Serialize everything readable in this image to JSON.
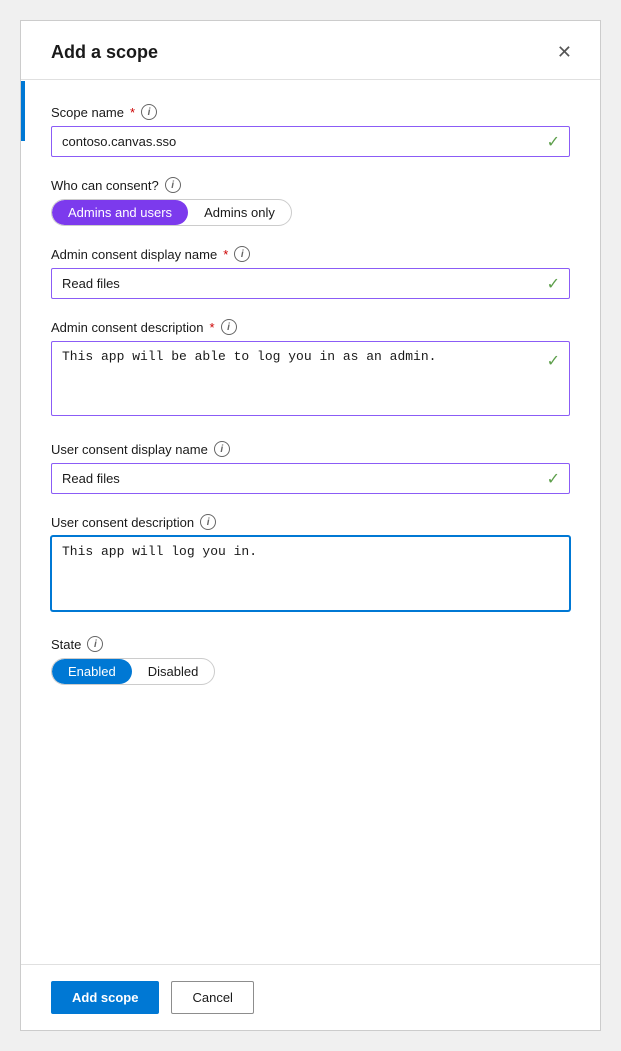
{
  "dialog": {
    "title": "Add a scope",
    "close_label": "✕"
  },
  "form": {
    "scope_name_label": "Scope name",
    "scope_name_value": "contoso.canvas.sso",
    "who_can_consent_label": "Who can consent?",
    "consent_option_admins_users": "Admins and users",
    "consent_option_admins_only": "Admins only",
    "admin_consent_display_name_label": "Admin consent display name",
    "admin_consent_display_name_value": "Read files",
    "admin_consent_description_label": "Admin consent description",
    "admin_consent_description_value": "This app will be able to log you in as an admin.",
    "user_consent_display_name_label": "User consent display name",
    "user_consent_display_name_value": "Read files",
    "user_consent_description_label": "User consent description",
    "user_consent_description_value": "This app will log you in.",
    "state_label": "State",
    "state_option_enabled": "Enabled",
    "state_option_disabled": "Disabled"
  },
  "footer": {
    "add_scope_label": "Add scope",
    "cancel_label": "Cancel"
  },
  "icons": {
    "info": "i",
    "check": "✓",
    "close": "✕"
  }
}
